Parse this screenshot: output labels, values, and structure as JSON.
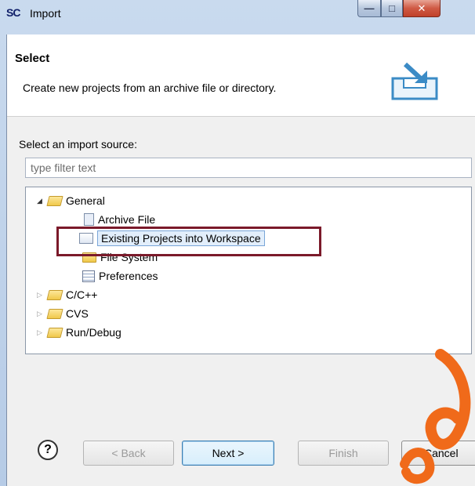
{
  "window": {
    "app_icon_text": "SC",
    "title": "Import"
  },
  "header": {
    "title": "Select",
    "description": "Create new projects from an archive file or directory.",
    "banner_icon": "import-wizard-icon"
  },
  "source": {
    "label": "Select an import source:",
    "filter_placeholder": "type filter text"
  },
  "tree": {
    "items": [
      {
        "label": "General",
        "icon": "folder-open-icon",
        "expanded": true
      },
      {
        "label": "Archive File",
        "icon": "archive-file-icon"
      },
      {
        "label": "Existing Projects into Workspace",
        "icon": "existing-projects-icon",
        "selected": true
      },
      {
        "label": "File System",
        "icon": "folder-icon"
      },
      {
        "label": "Preferences",
        "icon": "preferences-icon"
      },
      {
        "label": "C/C++",
        "icon": "folder-icon",
        "expanded": false
      },
      {
        "label": "CVS",
        "icon": "folder-icon",
        "expanded": false
      },
      {
        "label": "Run/Debug",
        "icon": "folder-icon",
        "expanded": false
      }
    ]
  },
  "buttons": {
    "help": "?",
    "back": "< Back",
    "next": "Next >",
    "finish": "Finish",
    "cancel": "Cancel"
  },
  "colors": {
    "highlight_box": "#7b1a2a",
    "watermark": "#f06a1a"
  }
}
